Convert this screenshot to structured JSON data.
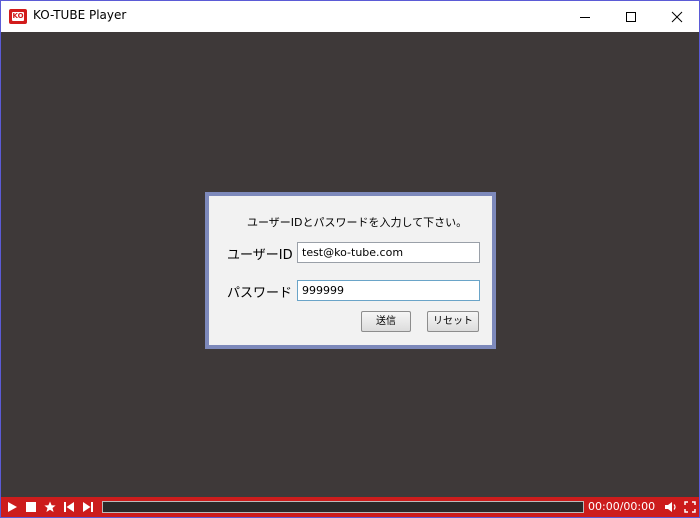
{
  "window": {
    "title": "KO-TUBE Player",
    "app_icon": "ko-tube-logo",
    "controls": [
      "minimize-icon",
      "maximize-icon",
      "close-icon"
    ]
  },
  "login_dialog": {
    "prompt": "ユーザーIDとパスワードを入力して下さい。",
    "user_id_label": "ユーザーID",
    "user_id_value": "test@ko-tube.com",
    "password_label": "パスワード",
    "password_value": "999999",
    "send_button": "送信",
    "reset_button": "リセット"
  },
  "player": {
    "controls": [
      "play-icon",
      "stop-icon",
      "star-icon",
      "previous-icon",
      "next-icon"
    ],
    "progress": 0,
    "time": "00:00/00:00",
    "right_controls": [
      "volume-icon",
      "fullscreen-icon"
    ]
  },
  "colors": {
    "accent": "#cc1c1c",
    "video_background": "#3e3939",
    "dialog_border": "#7d89bb"
  }
}
